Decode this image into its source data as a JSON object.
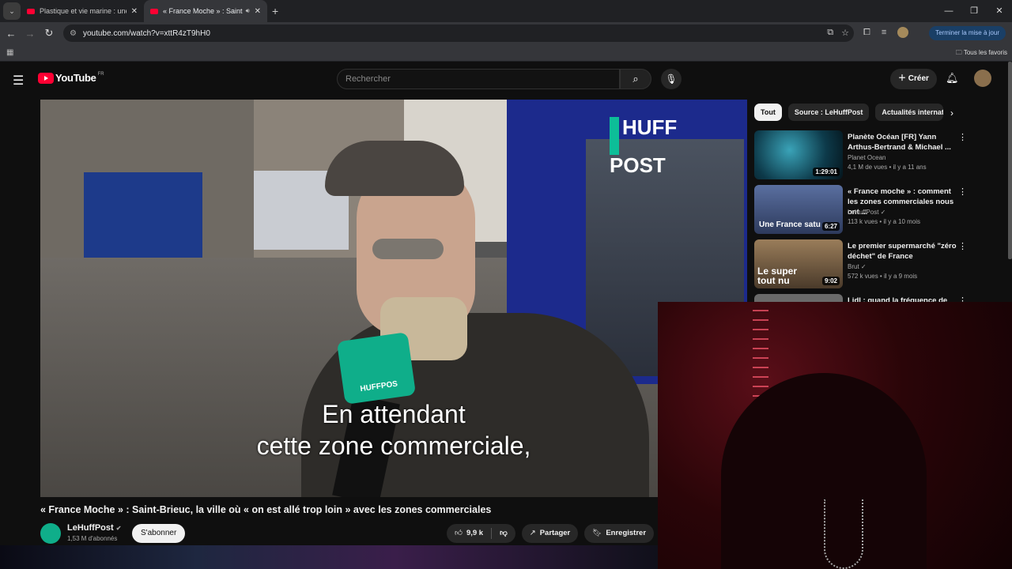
{
  "browser": {
    "tabs": [
      {
        "title": "Plastique et vie marine : une co",
        "active": false
      },
      {
        "title": "« France Moche » : Saint-Br",
        "active": true
      }
    ],
    "url": "youtube.com/watch?v=xttR4zT9hH0",
    "update_label": "Terminer la mise à jour",
    "bookmarks_label": "Tous les favoris"
  },
  "header": {
    "logo_text": "YouTube",
    "country": "FR",
    "search_placeholder": "Rechercher",
    "create_label": "Créer"
  },
  "video": {
    "overlay_brand": "HUFF POST",
    "mic_label": "HUFFPOS",
    "subtitle_line1": "En attendant",
    "subtitle_line2": "cette zone commerciale,",
    "title": "« France Moche » : Saint-Brieuc, la ville où « on est allé trop loin » avec les zones commerciales",
    "channel": "LeHuffPost",
    "subscribers": "1,53 M d'abonnés",
    "subscribe_label": "S'abonner",
    "likes": "9,9 k",
    "share_label": "Partager",
    "save_label": "Enregistrer"
  },
  "sidebar": {
    "chips": [
      "Tout",
      "Source : LeHuffPost",
      "Actualités internat"
    ],
    "recommendations": [
      {
        "title": "Planète Océan [FR] Yann Arthus-Bertrand & Michael ...",
        "channel": "Planet Ocean",
        "meta": "4,1 M de vues • il y a 11 ans",
        "duration": "1:29:01",
        "thumb_text": ""
      },
      {
        "title": "« France moche » : comment les zones commerciales nous ont ...",
        "channel": "LeHuffPost ✓",
        "meta": "113 k vues • il y a 10 mois",
        "duration": "6:27",
        "thumb_text": "Une France satu"
      },
      {
        "title": "Le premier supermarché \"zéro déchet\" de France",
        "channel": "Brut ✓",
        "meta": "572 k vues • il y a 9 mois",
        "duration": "9:02",
        "thumb_text": "Le super tout nu"
      },
      {
        "title": "Lidl : quand la fréquence de",
        "channel": "",
        "meta": "",
        "duration": "",
        "thumb_text": ""
      }
    ]
  },
  "colors": {
    "accent": "#ff0033",
    "huffpost_green": "#0dbe98"
  }
}
